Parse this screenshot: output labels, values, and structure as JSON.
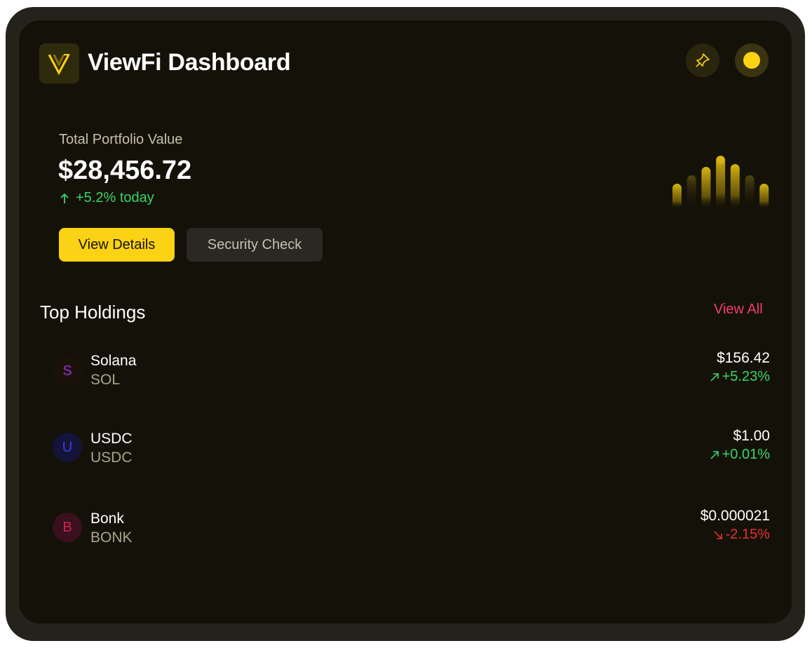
{
  "header": {
    "title": "ViewFi Dashboard",
    "logo_icon": "viewfi-v-logo",
    "pin_icon": "pin-icon",
    "theme_icon": "theme-toggle-icon"
  },
  "portfolio": {
    "label": "Total Portfolio Value",
    "value": "$28,456.72",
    "change": "+5.2% today",
    "spark_levels": [
      0.45,
      0.6,
      0.75,
      0.95,
      0.8,
      0.6,
      0.45
    ]
  },
  "actions": {
    "view_details": "View Details",
    "security_check": "Security Check"
  },
  "holdings": {
    "title": "Top Holdings",
    "view_all": "View All",
    "items": [
      {
        "letter": "S",
        "name": "Solana",
        "symbol": "SOL",
        "price": "$156.42",
        "change": "+5.23%",
        "direction": "up"
      },
      {
        "letter": "U",
        "name": "USDC",
        "symbol": "USDC",
        "price": "$1.00",
        "change": "+0.01%",
        "direction": "up"
      },
      {
        "letter": "B",
        "name": "Bonk",
        "symbol": "BONK",
        "price": "$0.000021",
        "change": "-2.15%",
        "direction": "down"
      }
    ]
  },
  "colors": {
    "accent": "#fcd214",
    "positive": "#39d46a",
    "negative": "#e53030",
    "link": "#f23d6d",
    "sol": "#9b2fd6",
    "usdc": "#3a3ee0",
    "bonk": "#d0234f"
  }
}
